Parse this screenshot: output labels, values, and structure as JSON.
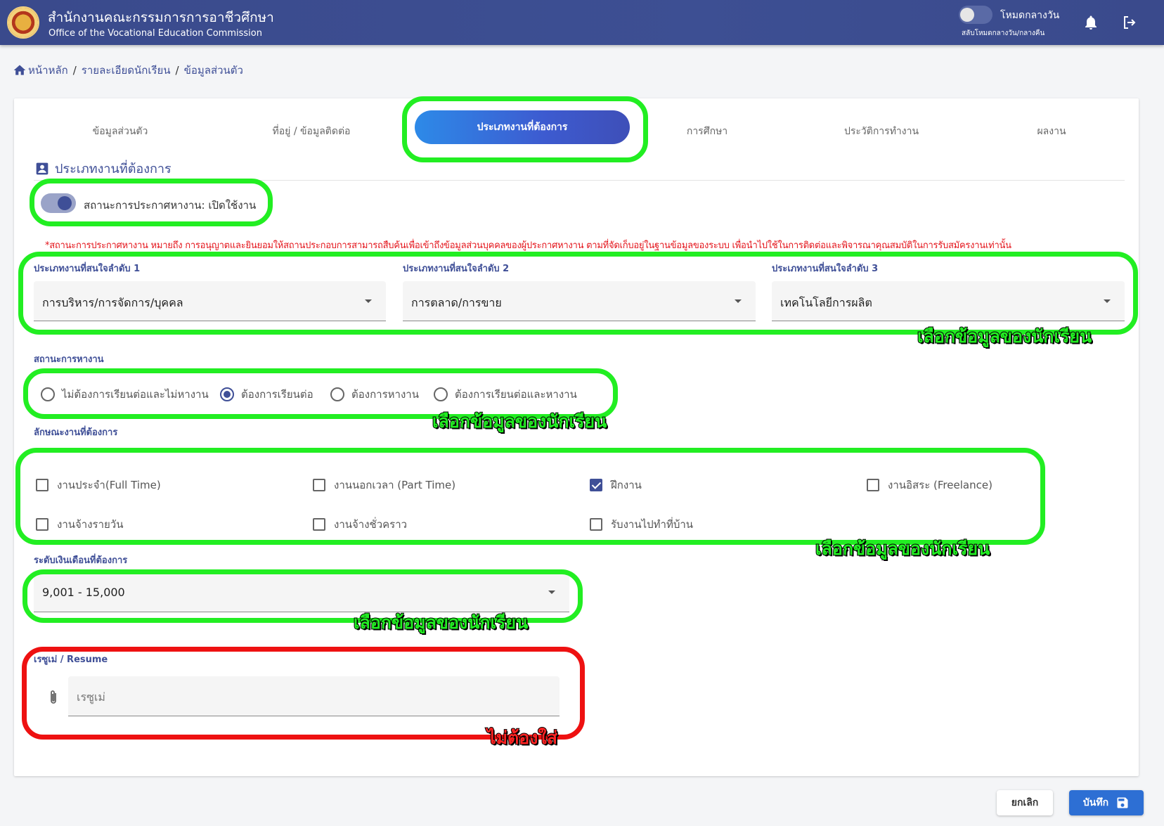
{
  "header": {
    "title": "สำนักงานคณะกรรมการการอาชีวศึกษา",
    "subtitle": "Office of the Vocational Education Commission",
    "mode_label": "โหมดกลางวัน",
    "mode_sub": "สลับโหมดกลางวัน/กลางคืน"
  },
  "breadcrumb": {
    "home": "หน้าหลัก",
    "level2": "รายละเอียดนักเรียน",
    "level3": "ข้อมูลส่วนตัว",
    "separator": "/"
  },
  "tabs": [
    {
      "label": "ข้อมูลส่วนตัว"
    },
    {
      "label": "ที่อยู่ / ข้อมูลติดต่อ"
    },
    {
      "label": "ประเภทงานที่ต้องการ"
    },
    {
      "label": "การศึกษา"
    },
    {
      "label": "ประวัติการทำงาน"
    },
    {
      "label": "ผลงาน"
    }
  ],
  "section": {
    "title": "ประเภทงานที่ต้องการ",
    "switch_label": "สถานะการประกาศหางาน: เปิดใช้งาน",
    "switch_on": true,
    "note": "*สถานะการประกาศหางาน หมายถึง การอนุญาตและยินยอมให้สถานประกอบการสามารถสืบค้นเพื่อเข้าถึงข้อมูลส่วนบุคคลของผู้ประกาศหางาน ตามที่จัดเก็บอยู่ในฐานข้อมูลของระบบ เพื่อนำไปใช้ในการติดต่อและพิจารณาคุณสมบัติในการรับสมัครงานเท่านั้น"
  },
  "interest": {
    "label1": "ประเภทงานที่สนใจลำดับ 1",
    "value1": "การบริหาร/การจัดการ/บุคคล",
    "label2": "ประเภทงานที่สนใจลำดับ 2",
    "value2": "การตลาด/การขาย",
    "label3": "ประเภทงานที่สนใจลำดับ 3",
    "value3": "เทคโนโลยีการผลิต"
  },
  "job_status": {
    "label": "สถานะการหางาน",
    "options": [
      {
        "label": "ไม่ต้องการเรียนต่อและไม่หางาน",
        "selected": false
      },
      {
        "label": "ต้องการเรียนต่อ",
        "selected": true
      },
      {
        "label": "ต้องการหางาน",
        "selected": false
      },
      {
        "label": "ต้องการเรียนต่อและหางาน",
        "selected": false
      }
    ]
  },
  "job_nature": {
    "label": "ลักษณะงานที่ต้องการ",
    "options": [
      {
        "label": "งานประจำ(Full Time)",
        "checked": false
      },
      {
        "label": "งานนอกเวลา (Part Time)",
        "checked": false
      },
      {
        "label": "ฝึกงาน",
        "checked": true
      },
      {
        "label": "งานอิสระ (Freelance)",
        "checked": false
      },
      {
        "label": "งานจ้างรายวัน",
        "checked": false
      },
      {
        "label": "งานจ้างชั่วคราว",
        "checked": false
      },
      {
        "label": "รับงานไปทำที่บ้าน",
        "checked": false
      }
    ]
  },
  "salary": {
    "label": "ระดับเงินเดือนที่ต้องการ",
    "value": "9,001 - 15,000"
  },
  "resume": {
    "label": "เรซูเม่ / Resume",
    "placeholder": "เรซูเม่"
  },
  "buttons": {
    "cancel": "ยกเลิก",
    "save": "บันทึก"
  },
  "annotations": {
    "select_student_data": "เลือกข้อมูลของนักเรียน",
    "not_required": "ไม่ต้องใส่"
  },
  "colors": {
    "primary": "#3f4f97",
    "header": "#3a4a8c",
    "highlight_green": "#22ee22",
    "highlight_red": "#ee1111",
    "note_red": "#e4141b",
    "save_button": "#2d6fd4"
  }
}
